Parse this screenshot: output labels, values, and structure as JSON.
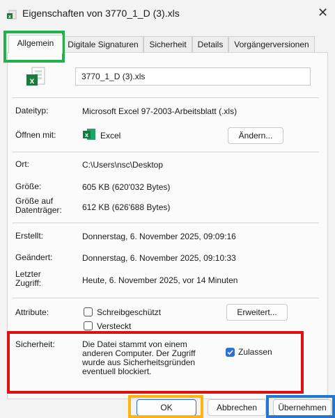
{
  "window": {
    "title": "Eigenschaften von 3770_1_D (3).xls",
    "close_glyph": "✕"
  },
  "tabs": [
    {
      "label": "Allgemein",
      "active": true
    },
    {
      "label": "Digitale Signaturen",
      "active": false
    },
    {
      "label": "Sicherheit",
      "active": false
    },
    {
      "label": "Details",
      "active": false
    },
    {
      "label": "Vorgängerversionen",
      "active": false
    }
  ],
  "general": {
    "filename": "3770_1_D (3).xls",
    "filetype_label": "Dateityp:",
    "filetype_value": "Microsoft Excel 97-2003-Arbeitsblatt (.xls)",
    "openwith_label": "Öffnen mit:",
    "openwith_app": "Excel",
    "change_button": "Ändern...",
    "location_label": "Ort:",
    "location_value": "C:\\Users\\nsc\\Desktop",
    "size_label": "Größe:",
    "size_value": "605 KB (620'032 Bytes)",
    "disksize_label_1": "Größe auf",
    "disksize_label_2": "Datenträger:",
    "disksize_value": "612 KB (626'688 Bytes)",
    "created_label": "Erstellt:",
    "created_value": "Donnerstag, 6. November 2025, 09:09:16",
    "modified_label": "Geändert:",
    "modified_value": "Donnerstag, 6. November 2025, 09:10:33",
    "accessed_label_1": "Letzter",
    "accessed_label_2": "Zugriff:",
    "accessed_value": "Heute, 6. November 2025, vor 14 Minuten",
    "attributes_label": "Attribute:",
    "readonly_label": "Schreibgeschützt",
    "hidden_label": "Versteckt",
    "advanced_button": "Erweitert...",
    "security_label": "Sicherheit:",
    "security_text_1": "Die Datei stammt von einem",
    "security_text_2": "anderen Computer. Der Zugriff",
    "security_text_3": "wurde aus Sicherheitsgründen",
    "security_text_4": "eventuell blockiert.",
    "unblock_label": "Zulassen",
    "unblock_checked": true
  },
  "footer": {
    "ok": "OK",
    "cancel": "Abbrechen",
    "apply": "Übernehmen"
  },
  "colors": {
    "highlight_tab": "#22b14c",
    "highlight_security": "#e01010",
    "highlight_ok": "#ffb30f",
    "highlight_apply": "#1f78d1",
    "checkbox_accent": "#2f6fd6"
  },
  "icons": {
    "title": "excel-file-icon",
    "file": "excel-file-icon",
    "app": "excel-app-icon"
  }
}
